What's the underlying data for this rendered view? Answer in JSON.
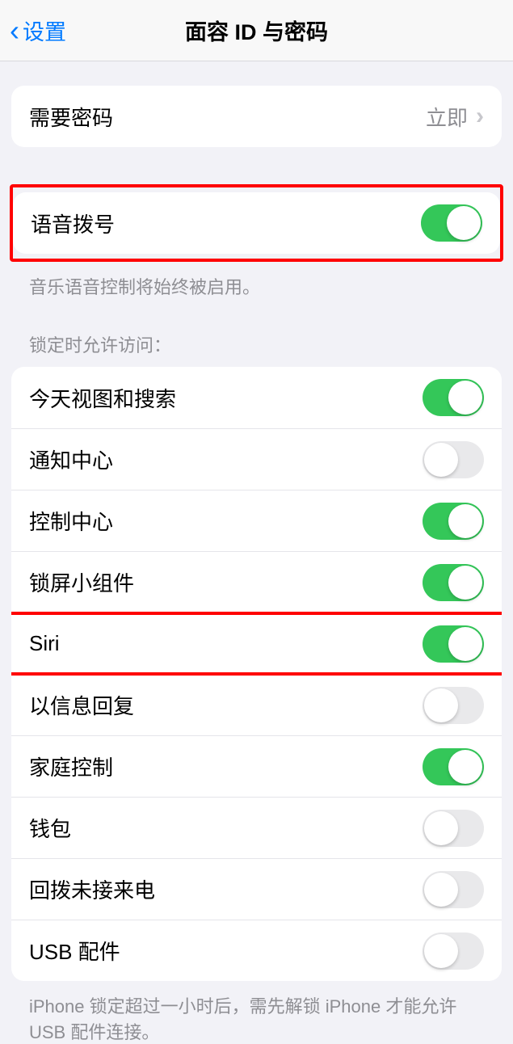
{
  "header": {
    "back_label": "设置",
    "title": "面容 ID 与密码"
  },
  "require_passcode": {
    "label": "需要密码",
    "value": "立即"
  },
  "voice_dial": {
    "label": "语音拨号",
    "on": true,
    "footer": "音乐语音控制将始终被启用。"
  },
  "locked_access": {
    "header": "锁定时允许访问：",
    "items": [
      {
        "label": "今天视图和搜索",
        "on": true
      },
      {
        "label": "通知中心",
        "on": false
      },
      {
        "label": "控制中心",
        "on": true
      },
      {
        "label": "锁屏小组件",
        "on": true
      },
      {
        "label": "Siri",
        "on": true
      },
      {
        "label": "以信息回复",
        "on": false
      },
      {
        "label": "家庭控制",
        "on": true
      },
      {
        "label": "钱包",
        "on": false
      },
      {
        "label": "回拨未接来电",
        "on": false
      },
      {
        "label": "USB 配件",
        "on": false
      }
    ],
    "footer": "iPhone 锁定超过一小时后，需先解锁 iPhone 才能允许 USB 配件连接。"
  }
}
